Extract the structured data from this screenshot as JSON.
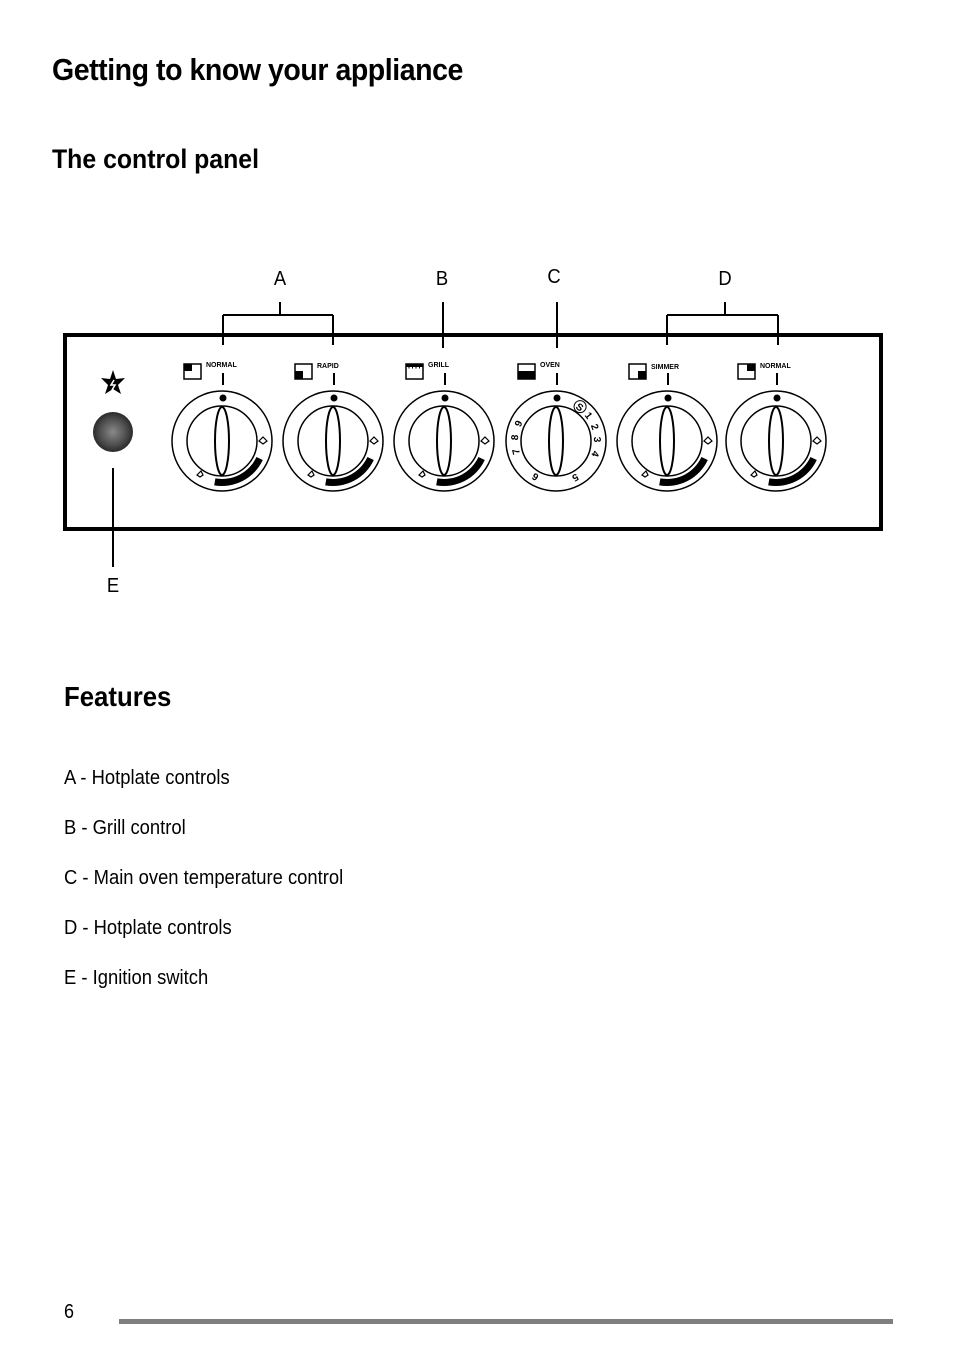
{
  "page": {
    "title": "Getting to know your appliance",
    "page_number": "6"
  },
  "control_panel": {
    "heading": "The control panel",
    "callouts": [
      "A",
      "B",
      "C",
      "D",
      "E"
    ],
    "knobs": [
      {
        "label": "NORMAL",
        "symbol": "hotplate-rear-left-icon",
        "type": "gas"
      },
      {
        "label": "RAPID",
        "symbol": "hotplate-front-left-icon",
        "type": "gas"
      },
      {
        "label": "GRILL",
        "symbol": "grill-icon",
        "type": "gas"
      },
      {
        "label": "OVEN",
        "symbol": "oven-icon",
        "type": "oven"
      },
      {
        "label": "SIMMER",
        "symbol": "hotplate-front-right-icon",
        "type": "gas"
      },
      {
        "label": "NORMAL",
        "symbol": "hotplate-rear-right-icon",
        "type": "gas"
      }
    ],
    "oven_dial_marks": [
      "S",
      "1",
      "2",
      "3",
      "4",
      "5",
      "6",
      "7",
      "8",
      "9"
    ],
    "ignition_symbol": "spark-icon"
  },
  "features": {
    "heading": "Features",
    "items": [
      "A - Hotplate controls",
      "B - Grill control",
      "C - Main oven temperature control",
      "D - Hotplate controls",
      "E - Ignition switch"
    ]
  }
}
